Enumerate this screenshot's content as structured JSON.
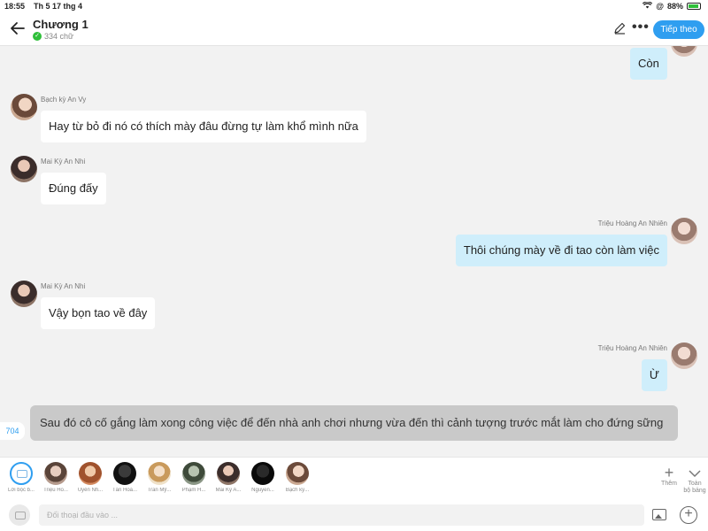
{
  "status": {
    "time": "18:55",
    "date": "Th 5 17 thg 4",
    "battery": "88%"
  },
  "header": {
    "title": "Chương 1",
    "word_count": "334 chữ",
    "next_label": "Tiếp theo"
  },
  "messages": [
    {
      "side": "right",
      "name": "",
      "text": "Còn"
    },
    {
      "side": "left",
      "name": "Bạch kỳ An Vy",
      "text": "Hay từ bỏ đi nó có thích mày đâu đừng tự làm khổ mình nữa"
    },
    {
      "side": "left",
      "name": "Mai Kỳ An Nhi",
      "text": "Đúng đấy"
    },
    {
      "side": "right",
      "name": "Triệu Hoàng An Nhiên",
      "text": "Thôi chúng mày về đi tao còn làm việc"
    },
    {
      "side": "left",
      "name": "Mai Kỳ An Nhi",
      "text": "Vậy bọn tao về đây"
    },
    {
      "side": "right",
      "name": "Triệu Hoàng An Nhiên",
      "text": "Ừ"
    }
  ],
  "narration": "Sau đó cô cố gắng làm xong công việc để đến nhà anh chơi nhưng vừa đến thì cảnh tượng trước mắt làm cho đứng sững",
  "narration_count": "704",
  "characters": [
    "Lời bộc b...",
    "Triệu Ho...",
    "Uyên Nh...",
    "Tân Hoà...",
    "Trần Mỹ...",
    "Phạm H...",
    "Mai Kỳ A...",
    "Nguyễn...",
    "Bạch kỳ..."
  ],
  "strip_actions": {
    "more": "Thêm",
    "all_line1": "Toàn",
    "all_line2": "bộ bảng"
  },
  "input": {
    "placeholder": "Đối thoại đầu vào ..."
  }
}
